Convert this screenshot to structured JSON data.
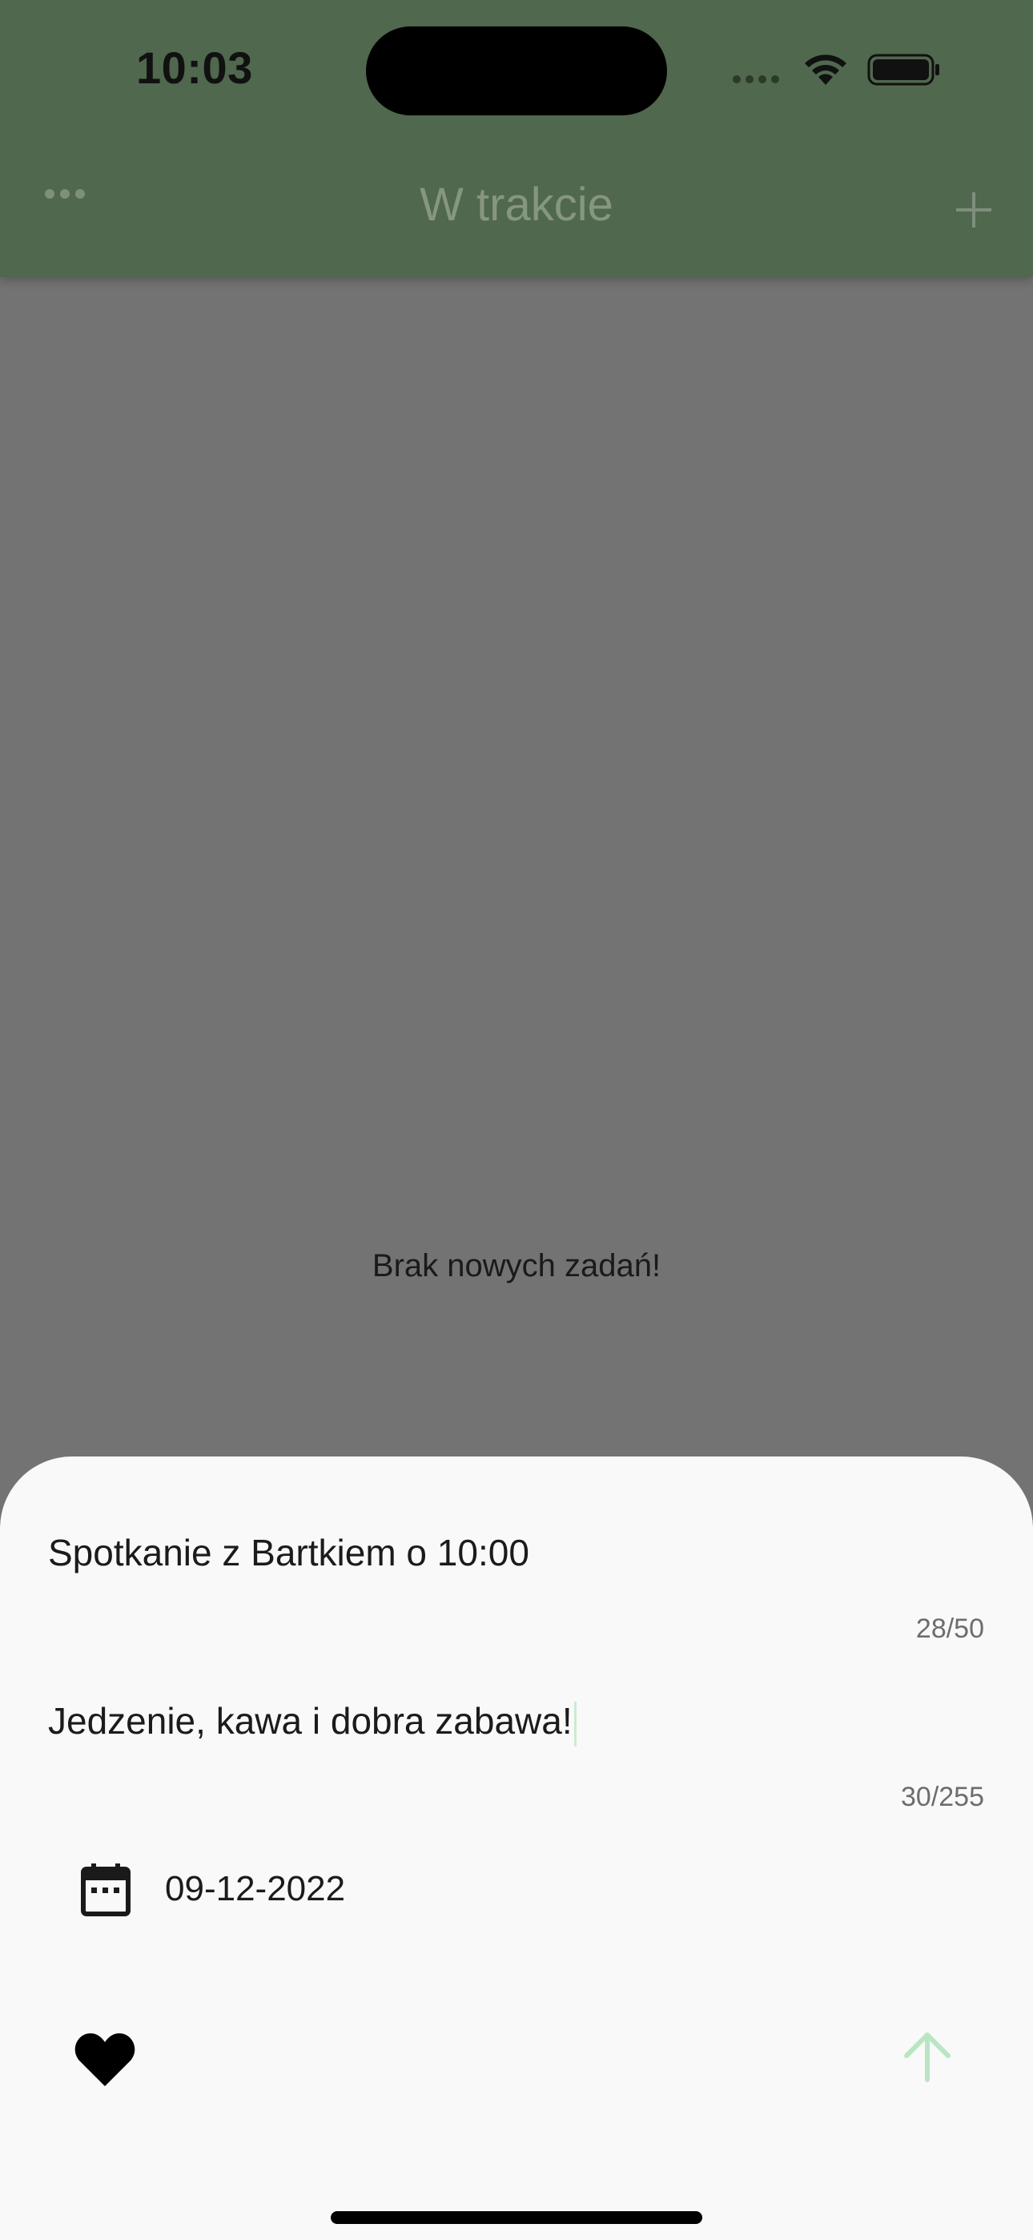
{
  "status_bar": {
    "time": "10:03"
  },
  "nav_bar": {
    "title": "W trakcie",
    "more_icon": "ellipsis-icon",
    "add_icon": "plus-icon"
  },
  "main": {
    "empty_message": "Brak nowych zadań!"
  },
  "sheet": {
    "title_value": "Spotkanie z Bartkiem o 10:00",
    "title_counter": "28/50",
    "description_value": "Jedzenie, kawa i dobra zabawa!",
    "description_counter": "30/255",
    "date_value": "09-12-2022",
    "date_icon": "calendar-icon",
    "favorite_icon": "heart-icon",
    "submit_icon": "arrow-up-icon"
  },
  "colors": {
    "nav_bar": "#50684d",
    "overlay": "#737373",
    "sheet_background": "#f9f9f9",
    "submit_accent": "#b8e6c3"
  }
}
